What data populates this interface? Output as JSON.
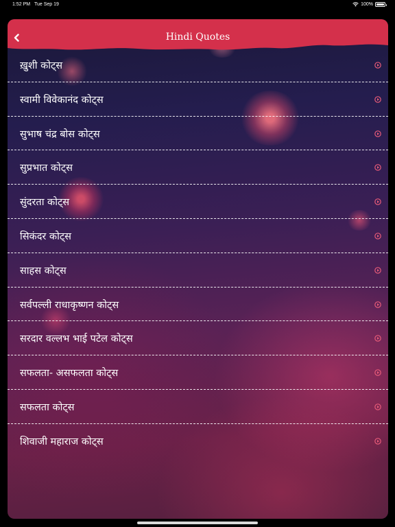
{
  "status_bar": {
    "time": "1:52 PM",
    "date": "Tue Sep 19",
    "battery": "100%"
  },
  "nav": {
    "title": "Hindi Quotes",
    "back_icon": "chevron-left-icon"
  },
  "colors": {
    "nav_red": "#d4304b",
    "play_icon": "#e65a78"
  },
  "items": [
    {
      "label": "ख़ुशी कोट्स"
    },
    {
      "label": "स्वामी विवेकानंद कोट्स"
    },
    {
      "label": "सुभाष चंद्र बोस कोट्स"
    },
    {
      "label": "सुप्रभात कोट्स"
    },
    {
      "label": "सुंदरता कोट्स"
    },
    {
      "label": "सिकंदर कोट्स"
    },
    {
      "label": "साहस कोट्स"
    },
    {
      "label": "सर्वपल्ली राधाकृष्णन कोट्स"
    },
    {
      "label": "सरदार वल्लभ भाई पटेल कोट्स"
    },
    {
      "label": "सफलता- असफलता कोट्स"
    },
    {
      "label": "सफलता कोट्स"
    },
    {
      "label": "शिवाजी महाराज कोट्स"
    }
  ]
}
